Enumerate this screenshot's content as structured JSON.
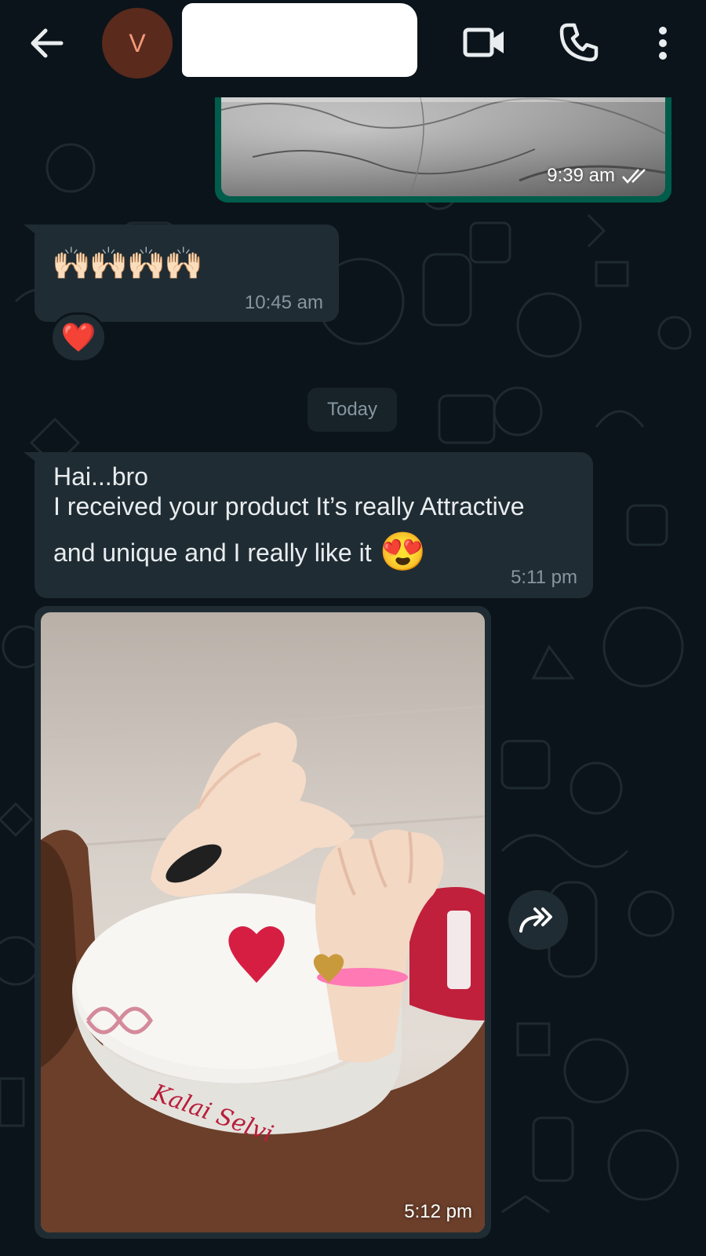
{
  "header": {
    "avatar_initial": "V",
    "contact_name": ""
  },
  "messages": {
    "sent_image": {
      "time": "9:39 am"
    },
    "clap_message": {
      "text": "🙌🏻🙌🏻🙌🏻🙌🏻",
      "time": "10:45 am",
      "reaction": "❤️"
    },
    "date_separator": "Today",
    "text_message": {
      "line1": "Hai...bro",
      "line2": "I received your product It’s really Attractive",
      "line3": "and unique and I really like it",
      "emoji": "😍",
      "time": "5:11 pm"
    },
    "photo_message": {
      "time": "5:12 pm",
      "engraving": "Kalai Selvi"
    }
  },
  "colors": {
    "background": "#0b141a",
    "incoming_bubble": "#202c33",
    "outgoing_bubble": "#005c4b",
    "meta_text": "#8696a0"
  },
  "icons": [
    "arrow-back-icon",
    "video-call-icon",
    "phone-icon",
    "more-vert-icon",
    "double-tick-icon",
    "forward-icon"
  ]
}
